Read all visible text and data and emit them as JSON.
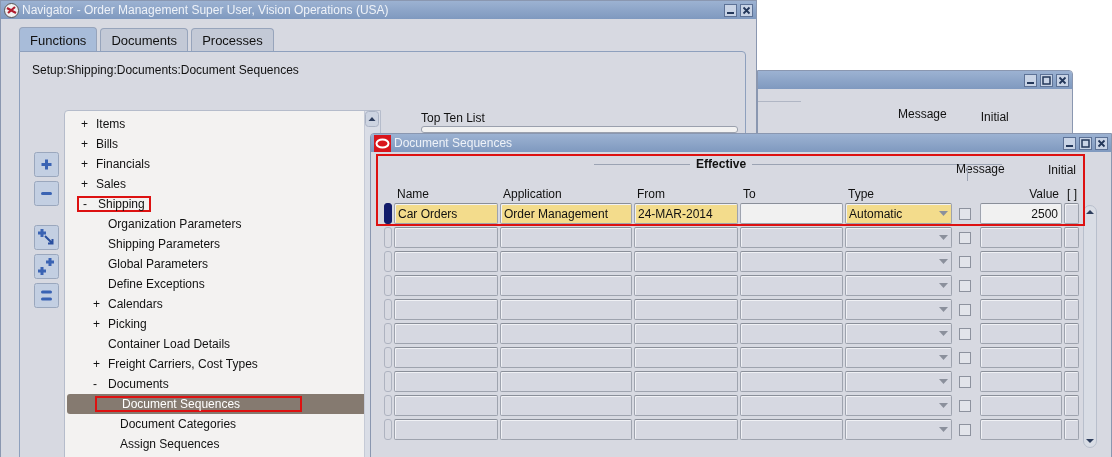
{
  "navigator": {
    "title": "Navigator - Order Management Super User, Vision Operations (USA)",
    "tabs": [
      {
        "label": "Functions",
        "selected": true
      },
      {
        "label": "Documents",
        "selected": false
      },
      {
        "label": "Processes",
        "selected": false
      }
    ],
    "path": "Setup:Shipping:Documents:Document Sequences",
    "tree": [
      {
        "marker": "+",
        "label": "Items",
        "selected": false,
        "highlighted": false
      },
      {
        "marker": "+",
        "label": "Bills",
        "selected": false,
        "highlighted": false
      },
      {
        "marker": "+",
        "label": "Financials",
        "selected": false,
        "highlighted": false
      },
      {
        "marker": "+",
        "label": "Sales",
        "selected": false,
        "highlighted": false
      },
      {
        "marker": "-",
        "label": "Shipping",
        "selected": false,
        "highlighted": true,
        "children": [
          {
            "label": "Organization Parameters",
            "selected": false,
            "highlighted": false
          },
          {
            "label": "Shipping Parameters",
            "selected": false,
            "highlighted": false
          },
          {
            "label": "Global Parameters",
            "selected": false,
            "highlighted": false
          },
          {
            "label": "Define Exceptions",
            "selected": false,
            "highlighted": false
          },
          {
            "marker": "+",
            "label": "Calendars",
            "selected": false,
            "highlighted": false
          },
          {
            "marker": "+",
            "label": "Picking",
            "selected": false,
            "highlighted": false
          },
          {
            "label": "Container Load Details",
            "selected": false,
            "highlighted": false
          },
          {
            "marker": "+",
            "label": "Freight Carriers, Cost Types",
            "selected": false,
            "highlighted": false
          },
          {
            "marker": "-",
            "label": "Documents",
            "selected": false,
            "highlighted": false,
            "children": [
              {
                "label": "Document Sequences",
                "selected": true,
                "highlighted": true
              },
              {
                "label": "Document Categories",
                "selected": false,
                "highlighted": false
              },
              {
                "label": "Assign Sequences",
                "selected": false,
                "highlighted": false
              }
            ]
          }
        ]
      }
    ],
    "top_ten_label": "Top Ten List"
  },
  "background_window": {
    "headers": [
      "Message",
      "Initial"
    ]
  },
  "document_sequences": {
    "title": "Document Sequences",
    "highlighted": true,
    "group_label": "Effective",
    "columns": [
      {
        "label": "Name",
        "kind": "text",
        "required": true
      },
      {
        "label": "Application",
        "kind": "text",
        "required": true
      },
      {
        "label": "From",
        "kind": "text",
        "required": true
      },
      {
        "label": "To",
        "kind": "text",
        "required": false
      },
      {
        "label": "Type",
        "kind": "dropdown",
        "required": true
      }
    ],
    "message_label": "Message",
    "initial_label": "Initial",
    "value_label": "Value",
    "extra_label": "[ ]",
    "rows": [
      {
        "current": true,
        "cells": [
          "Car Orders",
          "Order Management",
          "24-MAR-2014",
          null,
          "Automatic"
        ],
        "message": false,
        "initial_value": "2500"
      },
      {
        "current": false,
        "message": false
      },
      {
        "current": false,
        "message": false
      },
      {
        "current": false,
        "message": false
      },
      {
        "current": false,
        "message": false
      },
      {
        "current": false,
        "message": false
      },
      {
        "current": false,
        "message": false
      },
      {
        "current": false,
        "message": false
      },
      {
        "current": false,
        "message": false
      },
      {
        "current": false,
        "message": false
      }
    ]
  }
}
